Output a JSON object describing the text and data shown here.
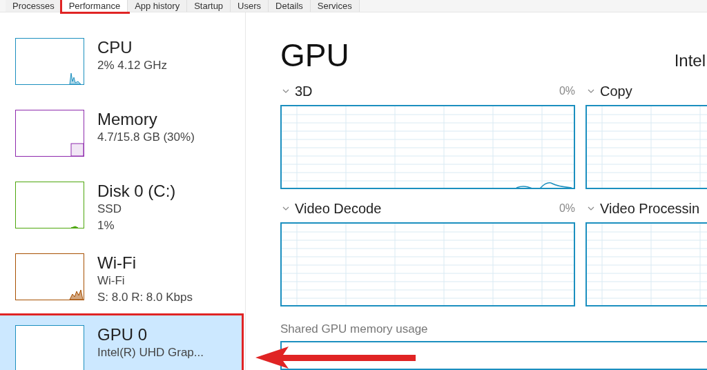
{
  "tabs": [
    {
      "label": "Processes",
      "selected": false,
      "highlighted": false
    },
    {
      "label": "Performance",
      "selected": true,
      "highlighted": true
    },
    {
      "label": "App history",
      "selected": false,
      "highlighted": false
    },
    {
      "label": "Startup",
      "selected": false,
      "highlighted": false
    },
    {
      "label": "Users",
      "selected": false,
      "highlighted": false
    },
    {
      "label": "Details",
      "selected": false,
      "highlighted": false
    },
    {
      "label": "Services",
      "selected": false,
      "highlighted": false
    }
  ],
  "sidebar": {
    "items": [
      {
        "name": "CPU",
        "lines": [
          "2% 4.12 GHz"
        ],
        "color": "#1b8fbf",
        "kind": "cpu",
        "selected": false,
        "highlighted": false
      },
      {
        "name": "Memory",
        "lines": [
          "4.7/15.8 GB (30%)"
        ],
        "color": "#8e2aad",
        "kind": "memory",
        "selected": false,
        "highlighted": false
      },
      {
        "name": "Disk 0 (C:)",
        "lines": [
          "SSD",
          "1%"
        ],
        "color": "#4da60c",
        "kind": "disk",
        "selected": false,
        "highlighted": false
      },
      {
        "name": "Wi-Fi",
        "lines": [
          "Wi-Fi",
          "S: 8.0 R: 8.0 Kbps"
        ],
        "color": "#a74f01",
        "kind": "network",
        "selected": false,
        "highlighted": false
      },
      {
        "name": "GPU 0",
        "lines": [
          "Intel(R) UHD Grap..."
        ],
        "color": "#1b8fbf",
        "kind": "gpu",
        "selected": true,
        "highlighted": true
      }
    ]
  },
  "main": {
    "title": "GPU",
    "adapter": "Intel",
    "graphs": [
      {
        "label": "3D",
        "value": "0%",
        "kind": "active"
      },
      {
        "label": "Copy",
        "kind": "idle"
      },
      {
        "label": "Video Decode",
        "value": "0%",
        "kind": "idle"
      },
      {
        "label": "Video Processin",
        "kind": "idle"
      }
    ],
    "shared_memory_label": "Shared GPU memory usage"
  }
}
